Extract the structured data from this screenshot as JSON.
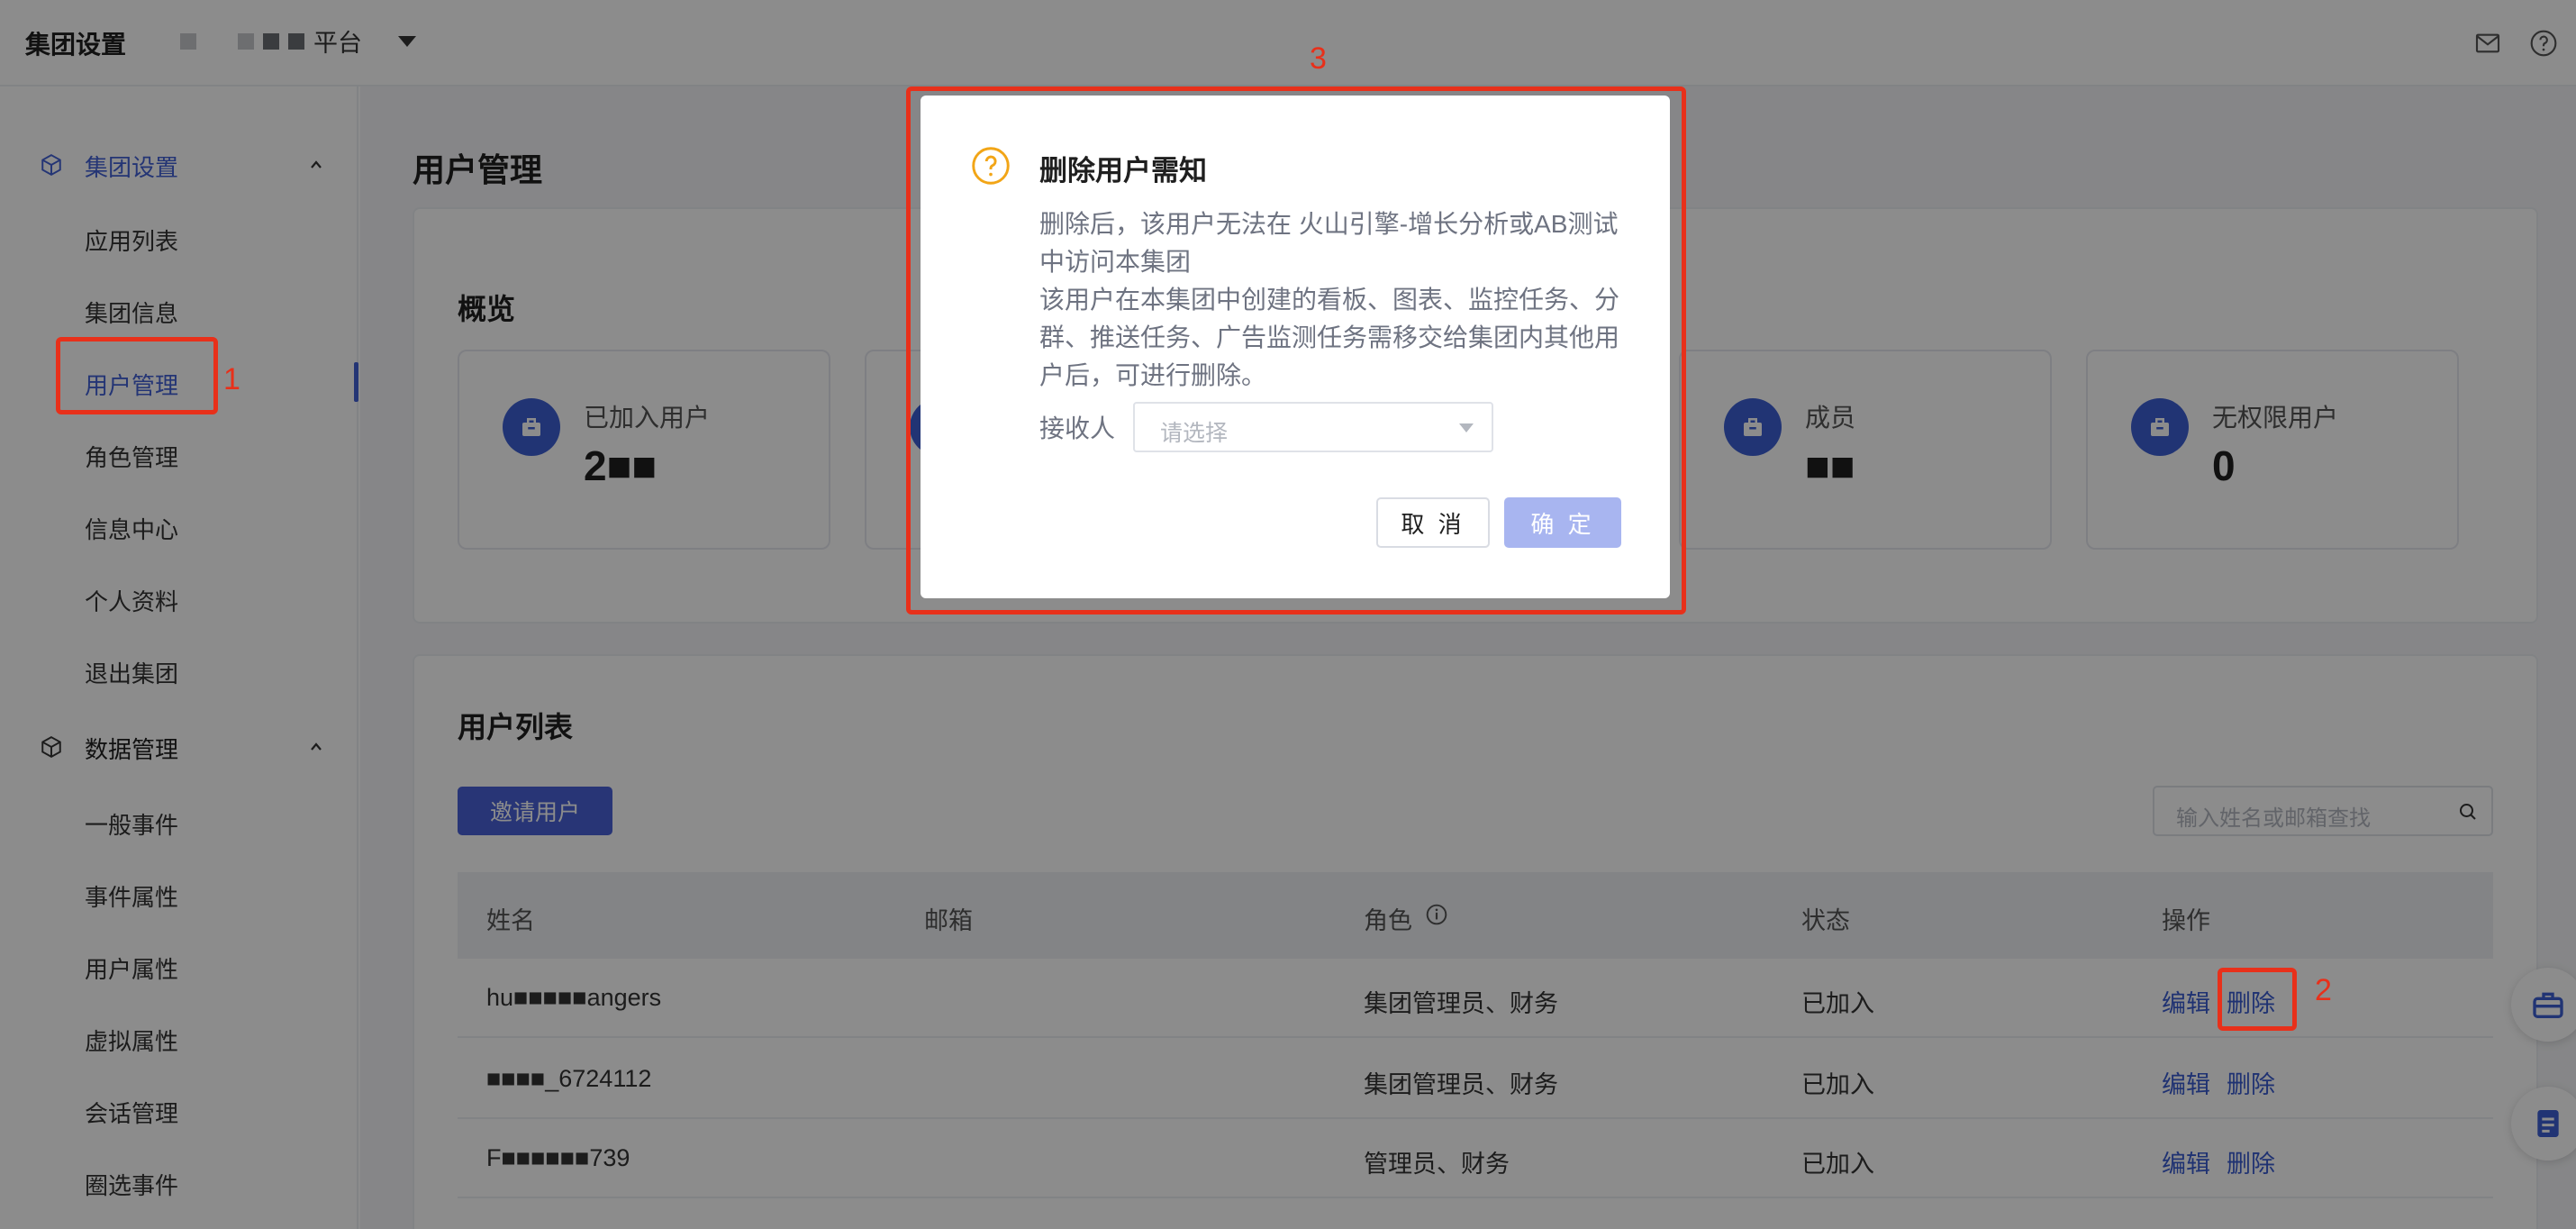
{
  "app": {
    "title": "集团设置",
    "platform_suffix": "平台"
  },
  "sidebar": {
    "groups": [
      {
        "label": "集团设置",
        "items": [
          "应用列表",
          "集团信息",
          "用户管理",
          "角色管理",
          "信息中心",
          "个人资料",
          "退出集团"
        ]
      },
      {
        "label": "数据管理",
        "items": [
          "一般事件",
          "事件属性",
          "用户属性",
          "虚拟属性",
          "会话管理",
          "圈选事件"
        ]
      }
    ],
    "active_item": "用户管理"
  },
  "page": {
    "title": "用户管理"
  },
  "overview": {
    "title": "概览",
    "stats": [
      {
        "label": "已加入用户",
        "value": "2■■"
      },
      {
        "label": "",
        "value": ""
      },
      {
        "label": "",
        "value": ""
      },
      {
        "label": "成员",
        "value": "■■"
      },
      {
        "label": "无权限用户",
        "value": "0"
      }
    ]
  },
  "user_list": {
    "title": "用户列表",
    "invite_label": "邀请用户",
    "search_placeholder": "输入姓名或邮箱查找",
    "columns": [
      "姓名",
      "邮箱",
      "角色",
      "状态",
      "操作"
    ],
    "rows": [
      {
        "name": "hu■■■■■angers",
        "email": "",
        "role": "集团管理员、财务",
        "status": "已加入",
        "edit": "编辑",
        "delete": "删除"
      },
      {
        "name": "■■■■_6724112",
        "email": "",
        "role": "集团管理员、财务",
        "status": "已加入",
        "edit": "编辑",
        "delete": "删除"
      },
      {
        "name": "F■■■■■■739",
        "email": "",
        "role": "管理员、财务",
        "status": "已加入",
        "edit": "编辑",
        "delete": "删除"
      }
    ]
  },
  "modal": {
    "title": "删除用户需知",
    "body_line1": "删除后，该用户无法在 火山引擎-增长分析或AB测试中访问本集团",
    "body_line2": "该用户在本集团中创建的看板、图表、监控任务、分群、推送任务、广告监测任务需移交给集团内其他用户后，可进行删除。",
    "recipient_label": "接收人",
    "recipient_placeholder": "请选择",
    "cancel_label": "取 消",
    "ok_label": "确 定"
  },
  "annotations": [
    "1",
    "2",
    "3"
  ],
  "colors": {
    "accent": "#4361d6",
    "annotation": "#e8301a",
    "warning": "#f2a516"
  }
}
